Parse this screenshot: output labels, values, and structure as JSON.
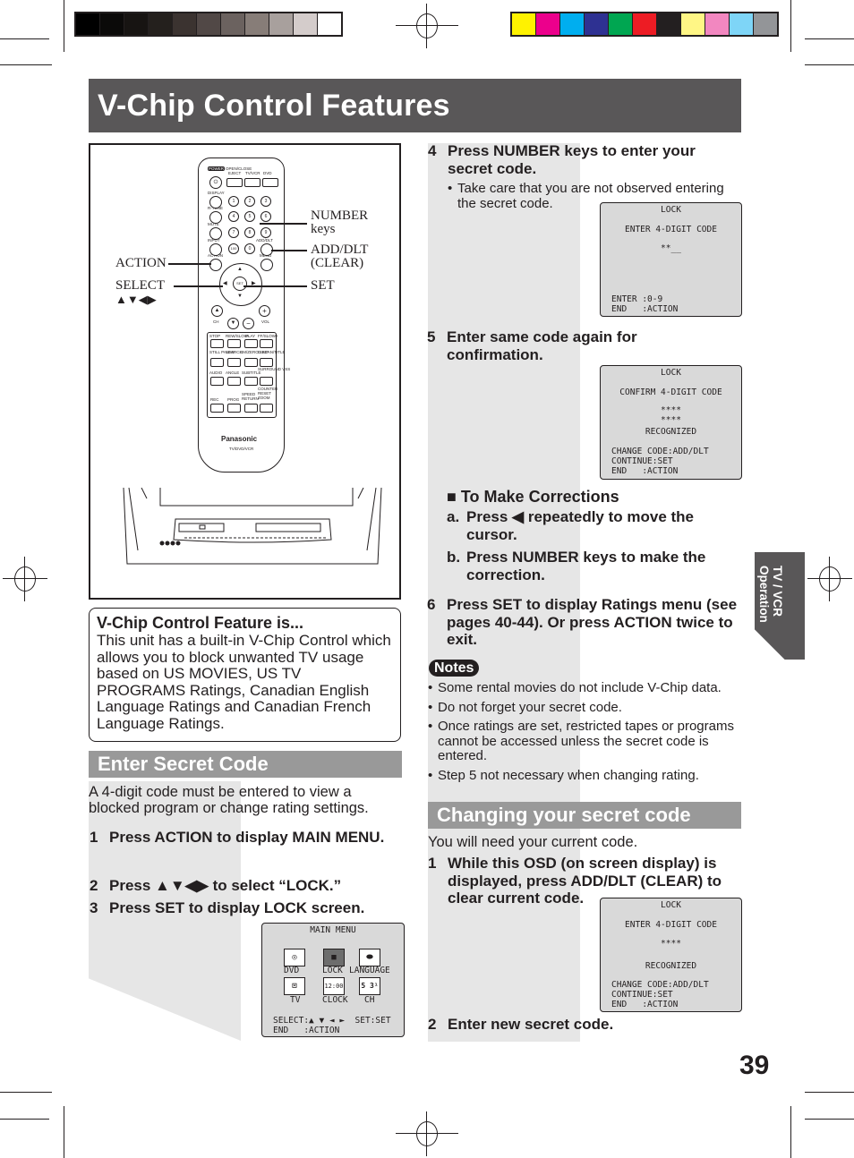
{
  "page": {
    "title": "V-Chip Control Features",
    "page_number": "39",
    "side_tab": [
      "TV / VCR",
      "Operation"
    ]
  },
  "print_marks": {
    "grayscale_bars": [
      "#000000",
      "#0b0a09",
      "#171412",
      "#24201d",
      "#3b3330",
      "#514846",
      "#6b625f",
      "#877d78",
      "#a8a09d",
      "#d4cccb",
      "#ffffff"
    ],
    "color_bars": [
      "#fff200",
      "#ec008c",
      "#00aeef",
      "#2e3192",
      "#00a651",
      "#ed1c24",
      "#231f20",
      "#fff685",
      "#f287c0",
      "#7ed5f7",
      "#939598"
    ]
  },
  "colors": {
    "title_bar": "#595758",
    "section_header": "#999999",
    "shade": "#e6e6e6",
    "osd_bg": "#d9d9d9",
    "text": "#231f20"
  },
  "figure": {
    "callouts": {
      "number_keys": [
        "NUMBER",
        "keys"
      ],
      "add_dlt": [
        "ADD/DLT",
        "(CLEAR)"
      ],
      "action": "ACTION",
      "select": [
        "SELECT",
        "▲▼◀▶"
      ],
      "set": "SET"
    },
    "remote": {
      "brand": "Panasonic",
      "model": "TV/DVD/VCR",
      "top_labels": [
        "POWER",
        "OPEN/CLOSE",
        "EJECT",
        "TV/VCR",
        "DVD"
      ],
      "side_labels": [
        "DISPLAY",
        "R-TUNE",
        "MUTE",
        "INPUT",
        "ACTION",
        "ADD/DLT",
        "MENU",
        "CH",
        "VOL"
      ],
      "number_keys": [
        "1",
        "2",
        "3",
        "4",
        "5",
        "6",
        "7",
        "8",
        "9",
        "100",
        "0"
      ],
      "transport_labels": [
        "STOP",
        "REW/SLOW-",
        "PLAY",
        "FF/SLOW+",
        "STILL PAUSE",
        "SEARCH",
        "CM/ZERO SKIP",
        "D.SCAN/TITLE",
        "AUDIO",
        "ANGLE",
        "SUBTITLE",
        "SURROUND VSS",
        "REC",
        "PROG",
        "SPEED RETURN",
        "COUNTER RESET ZOOM"
      ]
    }
  },
  "info_box": {
    "heading": "V-Chip Control Feature is...",
    "body": "This unit has a built-in V-Chip Control which allows you to block unwanted TV usage based on US MOVIES, US TV PROGRAMS Ratings, Canadian English Language Ratings and Canadian French Language Ratings."
  },
  "enter_secret_code": {
    "heading": "Enter Secret Code",
    "intro": "A 4-digit code must be entered to view a blocked program or change rating settings.",
    "steps": [
      {
        "num": "1",
        "text": "Press ACTION to display MAIN MENU."
      },
      {
        "num": "2",
        "text": "Press ▲▼◀▶ to select “LOCK.”"
      },
      {
        "num": "3",
        "text": "Press SET to display LOCK screen."
      }
    ],
    "main_menu_osd": {
      "title": "MAIN MENU",
      "items": [
        "DVD",
        "LOCK",
        "LANGUAGE",
        "TV",
        "CLOCK",
        "CH"
      ],
      "selected": "LOCK",
      "footer": [
        "SELECT:▲ ▼ ◄ ►  SET:SET",
        "END   :ACTION"
      ]
    },
    "step4": {
      "num": "4",
      "text": "Press NUMBER keys to enter your secret code."
    },
    "step4_note": "Take care that you are not observed entering the secret code.",
    "lock_osd_1": {
      "title": "LOCK",
      "line1": "ENTER 4-DIGIT CODE",
      "code": "**__",
      "footer": [
        "ENTER :0-9",
        "END   :ACTION"
      ]
    },
    "step5": {
      "num": "5",
      "text": "Enter same code again for confirmation."
    },
    "lock_osd_2": {
      "title": "LOCK",
      "line1": "CONFIRM 4-DIGIT CODE",
      "code1": "****",
      "code2": "****",
      "status": "RECOGNIZED",
      "footer": [
        "CHANGE CODE:ADD/DLT",
        "CONTINUE:SET",
        "END   :ACTION"
      ]
    },
    "corrections": {
      "heading": "To Make Corrections",
      "items": [
        {
          "letter": "a.",
          "text": "Press ◀ repeatedly to move the cursor."
        },
        {
          "letter": "b.",
          "text": "Press NUMBER keys to make the correction."
        }
      ]
    },
    "step6": {
      "num": "6",
      "text": "Press SET to display Ratings menu (see pages 40-44). Or press ACTION twice to exit."
    }
  },
  "notes": {
    "label": "Notes",
    "items": [
      "Some rental movies do not include V-Chip data.",
      "Do not forget your secret code.",
      "Once ratings are set, restricted tapes or programs cannot be accessed unless the secret code is entered.",
      "Step 5 not necessary when changing rating."
    ]
  },
  "change_code": {
    "heading": "Changing your secret code",
    "intro": "You will need your current code.",
    "steps": [
      {
        "num": "1",
        "text": "While this OSD (on screen display) is displayed, press ADD/DLT (CLEAR) to clear current code."
      },
      {
        "num": "2",
        "text": "Enter new secret code."
      }
    ],
    "lock_osd": {
      "title": "LOCK",
      "line1": "ENTER 4-DIGIT CODE",
      "code": "****",
      "status": "RECOGNIZED",
      "footer": [
        "CHANGE CODE:ADD/DLT",
        "CONTINUE:SET",
        "END   :ACTION"
      ]
    }
  }
}
